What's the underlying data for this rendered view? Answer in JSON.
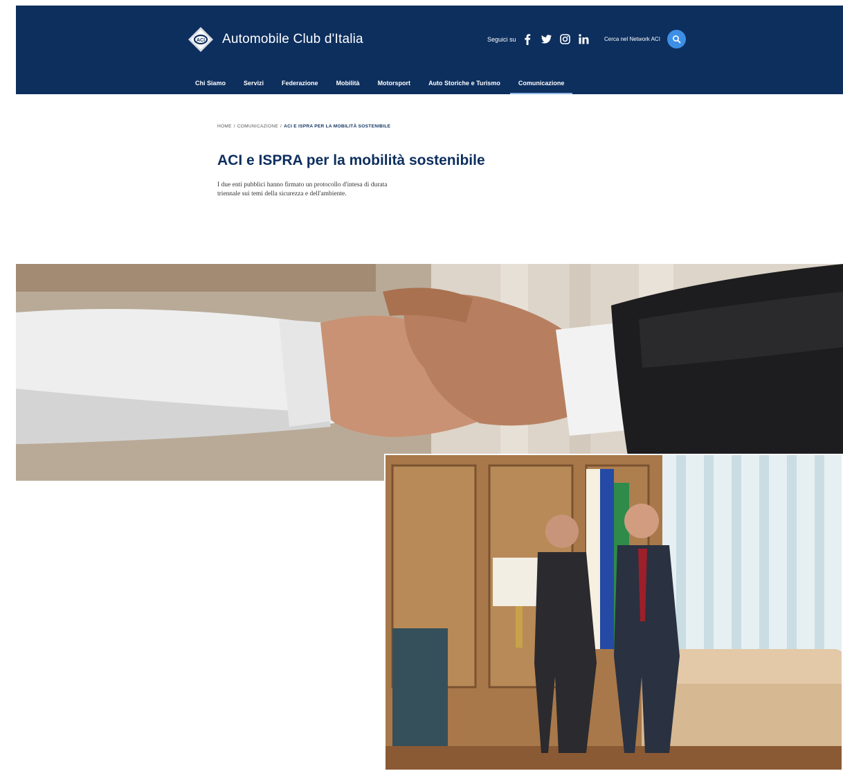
{
  "header": {
    "brand_name": "Automobile Club d'Italia",
    "follow_label": "Seguici su",
    "social": [
      "facebook-icon",
      "twitter-icon",
      "instagram-icon",
      "linkedin-icon"
    ],
    "search_label": "Cerca nel Network ACI",
    "colors": {
      "background": "#0d2f5e",
      "search_button": "#3d8fe6"
    }
  },
  "nav": {
    "items": [
      {
        "label": "Chi Siamo"
      },
      {
        "label": "Servizi"
      },
      {
        "label": "Federazione"
      },
      {
        "label": "Mobilità"
      },
      {
        "label": "Motorsport"
      },
      {
        "label": "Auto Storiche e Turismo"
      },
      {
        "label": "Comunicazione"
      }
    ],
    "active": "Comunicazione"
  },
  "breadcrumb": {
    "home": "HOME",
    "section": "COMUNICAZIONE",
    "current": "ACI E ISPRA PER LA MOBILITÀ SOSTENIBILE",
    "separator": "/"
  },
  "article": {
    "title": "ACI e ISPRA per la mobilità sostenibile",
    "subtitle": "I due enti pubblici hanno firmato un protocollo d'intesa di durata triennale sui temi della sicurezza e dell'ambiente."
  }
}
